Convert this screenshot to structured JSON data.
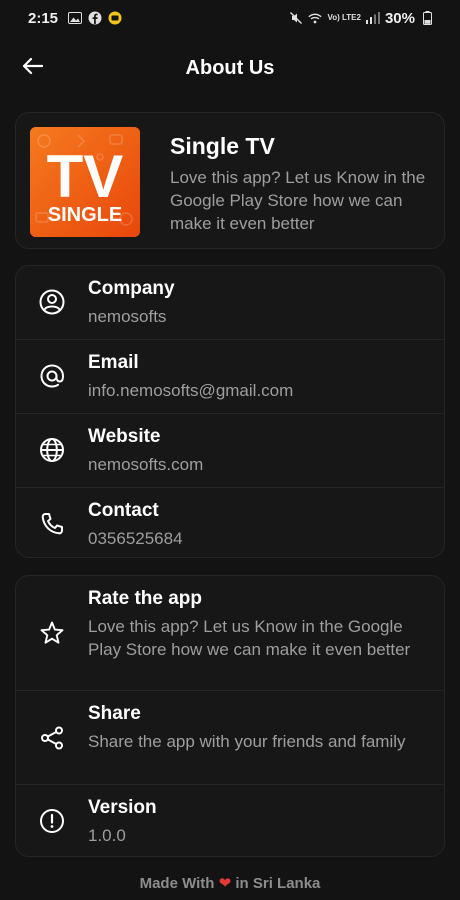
{
  "status_bar": {
    "time": "2:15",
    "battery": "30%",
    "network": "Vo) LTE2"
  },
  "app_bar": {
    "title": "About Us"
  },
  "app_card": {
    "name": "Single TV",
    "description": "Love this app? Let us Know in the Google Play Store how we can make it even better",
    "logo_text_top": "TV",
    "logo_text_bottom": "SINGLE",
    "logo_color": "#f05a12"
  },
  "contact": [
    {
      "title": "Company",
      "value": "nemosofts",
      "icon": "account-circle-icon"
    },
    {
      "title": "Email",
      "value": "info.nemosofts@gmail.com",
      "icon": "at-sign-icon"
    },
    {
      "title": "Website",
      "value": "nemosofts.com",
      "icon": "globe-icon"
    },
    {
      "title": "Contact",
      "value": "0356525684",
      "icon": "phone-icon"
    }
  ],
  "links": [
    {
      "title": "Rate the app",
      "value": "Love this app? Let us Know in the Google Play Store how we can make it even better",
      "icon": "star-icon"
    },
    {
      "title": "Share",
      "value": "Share the app with your friends and family",
      "icon": "share-icon"
    },
    {
      "title": "Version",
      "value": "1.0.0",
      "icon": "info-icon"
    }
  ],
  "footer": {
    "prefix": "Made With",
    "suffix": "in Sri Lanka",
    "heart": "❤"
  },
  "colors": {
    "background": "#131313",
    "card": "#171717",
    "muted_text": "#9e9e9e",
    "heart": "#e53935"
  }
}
